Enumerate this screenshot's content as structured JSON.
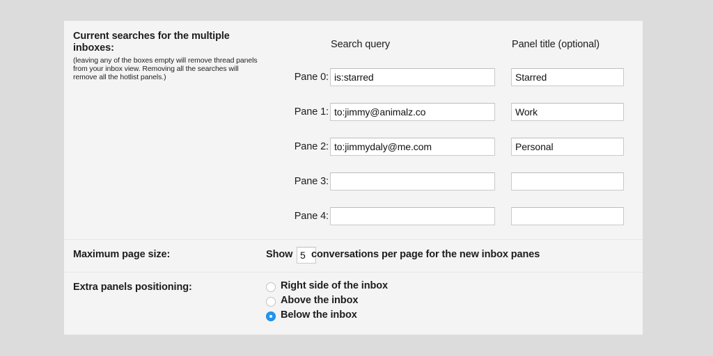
{
  "searches_section": {
    "heading": "Current searches for the multiple inboxes:",
    "note": "(leaving any of the boxes empty will remove thread panels from your inbox view. Removing all the searches will remove all the hotlist panels.)",
    "column_headers": {
      "query": "Search query",
      "title": "Panel title (optional)"
    },
    "panes": [
      {
        "label": "Pane 0:",
        "query": "is:starred",
        "title": "Starred"
      },
      {
        "label": "Pane 1:",
        "query": "to:jimmy@animalz.co",
        "title": "Work"
      },
      {
        "label": "Pane 2:",
        "query": "to:jimmydaly@me.com",
        "title": "Personal"
      },
      {
        "label": "Pane 3:",
        "query": "",
        "title": ""
      },
      {
        "label": "Pane 4:",
        "query": "",
        "title": ""
      }
    ]
  },
  "page_size_section": {
    "label": "Maximum page size:",
    "show_word": "Show",
    "value": "5",
    "suffix": "conversations per page for the new inbox panes"
  },
  "positioning_section": {
    "label": "Extra panels positioning:",
    "options": [
      {
        "label": "Right side of the inbox",
        "selected": false
      },
      {
        "label": "Above the inbox",
        "selected": false
      },
      {
        "label": "Below the inbox",
        "selected": true
      }
    ]
  },
  "colors": {
    "page_background": "#dcdcdc",
    "panel_background": "#f4f4f4",
    "divider": "#e6e6e6",
    "input_border": "#c9c9c9",
    "radio_accent": "#2196f3",
    "text": "#1d1d1d"
  }
}
